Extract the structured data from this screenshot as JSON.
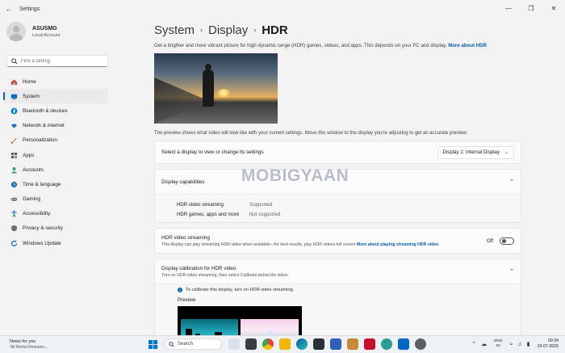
{
  "window": {
    "title": "Settings"
  },
  "profile": {
    "name": "ASUSMG",
    "account_type": "Local Account"
  },
  "search": {
    "placeholder": "Find a setting"
  },
  "sidebar": {
    "items": [
      {
        "label": "Home",
        "icon": "home-icon",
        "color": "#c0504d"
      },
      {
        "label": "System",
        "icon": "system-icon",
        "color": "#0067c0",
        "active": true
      },
      {
        "label": "Bluetooth & devices",
        "icon": "bluetooth-icon",
        "color": "#0078d4"
      },
      {
        "label": "Network & internet",
        "icon": "network-icon",
        "color": "#1a73c8"
      },
      {
        "label": "Personalization",
        "icon": "personalization-icon",
        "color": "#d38535"
      },
      {
        "label": "Apps",
        "icon": "apps-icon",
        "color": "#5b5f66"
      },
      {
        "label": "Accounts",
        "icon": "accounts-icon",
        "color": "#2aa36b"
      },
      {
        "label": "Time & language",
        "icon": "time-language-icon",
        "color": "#1f6fb5"
      },
      {
        "label": "Gaming",
        "icon": "gaming-icon",
        "color": "#6b6f76"
      },
      {
        "label": "Accessibility",
        "icon": "accessibility-icon",
        "color": "#1b6ec2"
      },
      {
        "label": "Privacy & security",
        "icon": "privacy-shield-icon",
        "color": "#6b6f76"
      },
      {
        "label": "Windows Update",
        "icon": "windows-update-icon",
        "color": "#0067c0"
      }
    ]
  },
  "breadcrumb": {
    "level1": "System",
    "level2": "Display",
    "current": "HDR"
  },
  "intro": {
    "text": "Get a brighter and more vibrant picture for high dynamic range (HDR) games, videos, and apps. This depends on your PC and display.",
    "link": "More about HDR"
  },
  "preview_note": "The preview shows what video will look like with your current settings. Move this window to the display you're adjusting to get an accurate preview.",
  "display_select": {
    "label": "Select a display to view or change its settings",
    "value": "Display 1: Internal Display"
  },
  "capabilities": {
    "title": "Display capabilities",
    "rows": [
      {
        "key": "HDR video streaming",
        "value": "Supported"
      },
      {
        "key": "HDR games, apps and more",
        "value": "Not supported"
      }
    ]
  },
  "hdr_streaming": {
    "title": "HDR video streaming",
    "description": "This display can play streaming HDR video when available—for best results, play HDR videos full screen",
    "link": "More about playing streaming HDR video",
    "toggle_label": "Off"
  },
  "calibration": {
    "title": "Display calibration for HDR video",
    "description": "Turn on HDR video streaming, then select Calibrate below the video.",
    "info": "To calibrate this display, turn on HDR video streaming.",
    "preview_label": "Preview"
  },
  "watermark": "MOBIGYAAN",
  "taskbar": {
    "news_title": "News for you",
    "news_sub": "'All Mortal Remains...",
    "search_label": "Search",
    "lang_line1": "ENG",
    "lang_line2": "IN",
    "time": "00:34",
    "date": "19-07-2025"
  }
}
